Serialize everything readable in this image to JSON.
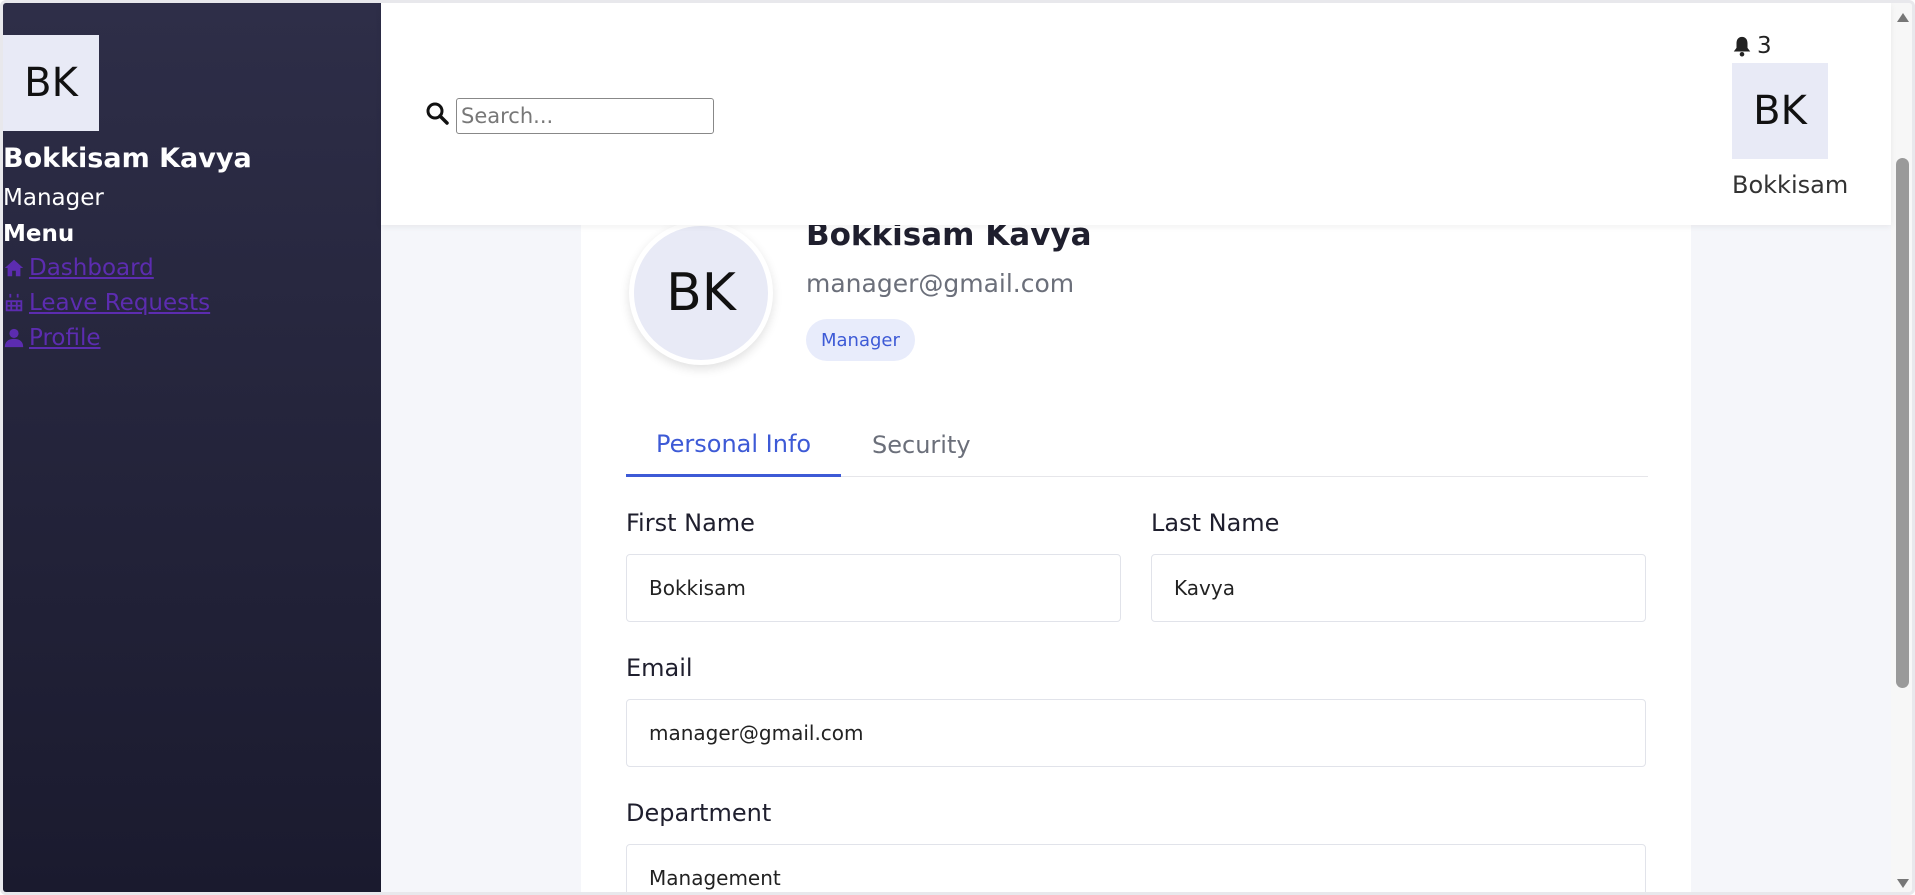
{
  "sidebar": {
    "avatar_initials": "BK",
    "user_name": "Bokkisam Kavya",
    "user_role": "Manager",
    "menu_title": "Menu",
    "items": [
      {
        "label": "Dashboard",
        "icon": "home-icon"
      },
      {
        "label": "Leave Requests",
        "icon": "calendar-icon"
      },
      {
        "label": "Profile",
        "icon": "user-icon"
      }
    ]
  },
  "header": {
    "search_placeholder": "Search...",
    "notification_count": "3",
    "avatar_initials": "BK",
    "user_name": "Bokkisam"
  },
  "profile": {
    "avatar_initials": "BK",
    "name": "Bokkisam Kavya",
    "email": "manager@gmail.com",
    "role_badge": "Manager"
  },
  "tabs": [
    {
      "label": "Personal Info",
      "active": true
    },
    {
      "label": "Security",
      "active": false
    }
  ],
  "form": {
    "first_name": {
      "label": "First Name",
      "value": "Bokkisam"
    },
    "last_name": {
      "label": "Last Name",
      "value": "Kavya"
    },
    "email": {
      "label": "Email",
      "value": "manager@gmail.com"
    },
    "department": {
      "label": "Department",
      "value": "Management"
    }
  },
  "colors": {
    "accent": "#3d5ad6",
    "sidebar_bg": "#1a1a2e",
    "link": "#5c2cb0"
  }
}
